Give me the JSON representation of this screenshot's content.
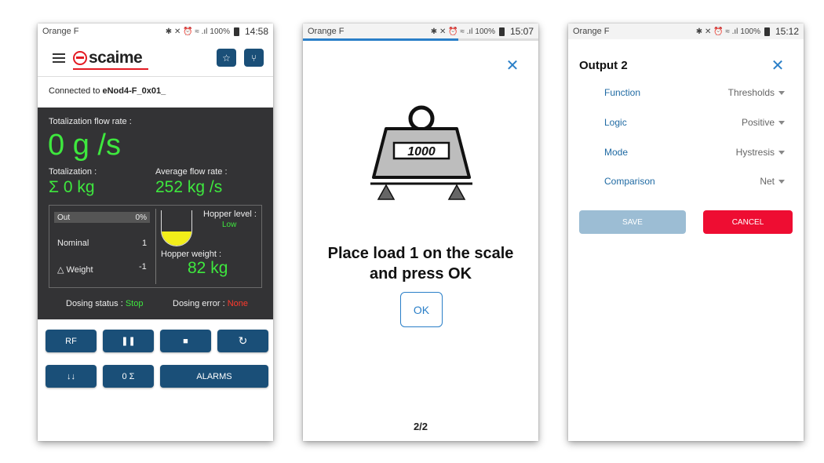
{
  "status": {
    "carrier": "Orange F",
    "signal_icons": "✱ ✕ ⏰ ≈ .ıl",
    "battery": "100%",
    "times": [
      "14:58",
      "15:07",
      "15:12"
    ]
  },
  "screen1": {
    "logo": "scaime",
    "connected_prefix": "Connected to ",
    "device": "eNod4-F_0x01_",
    "totalization_flow_rate_label": "Totalization flow rate :",
    "totalization_flow_rate": "0 g /s",
    "totalization_label": "Totalization :",
    "totalization": "Σ 0 kg",
    "average_flow_rate_label": "Average flow rate :",
    "average_flow_rate": "252 kg /s",
    "out_label": "Out",
    "out_value": "0%",
    "nominal_label": "Nominal",
    "nominal_value": "1",
    "weight_label": "Weight",
    "weight_value": "-1",
    "hopper_level_label": "Hopper level :",
    "hopper_level": "Low",
    "hopper_weight_label": "Hopper weight :",
    "hopper_weight": "82 kg",
    "dosing_status_label": "Dosing status : ",
    "dosing_status": "Stop",
    "dosing_error_label": "Dosing error : ",
    "dosing_error": "None",
    "buttons": {
      "rf": "RF",
      "pause": "❚❚",
      "stop": "■",
      "refresh": "↻",
      "down": "↓↓",
      "zero_sigma": "0 Σ",
      "alarms": "ALARMS"
    },
    "colors": {
      "panel": "#333335",
      "accent": "#1a4f78",
      "value_green": "#3ee83e",
      "error_red": "#ff3a2d"
    }
  },
  "screen2": {
    "weight_label": "1000",
    "instruction_line1": "Place load 1 on the scale",
    "instruction_line2": "and press OK",
    "ok": "OK",
    "pager": "2/2"
  },
  "screen3": {
    "title": "Output 2",
    "rows": [
      {
        "label": "Function",
        "value": "Thresholds"
      },
      {
        "label": "Logic",
        "value": "Positive"
      },
      {
        "label": "Mode",
        "value": "Hystresis"
      },
      {
        "label": "Comparison",
        "value": "Net"
      }
    ],
    "save": "SAVE",
    "cancel": "CANCEL",
    "colors": {
      "label_blue": "#1f6aa3",
      "save_bg": "#9cbdd4",
      "cancel_bg": "#ee0d32"
    }
  }
}
